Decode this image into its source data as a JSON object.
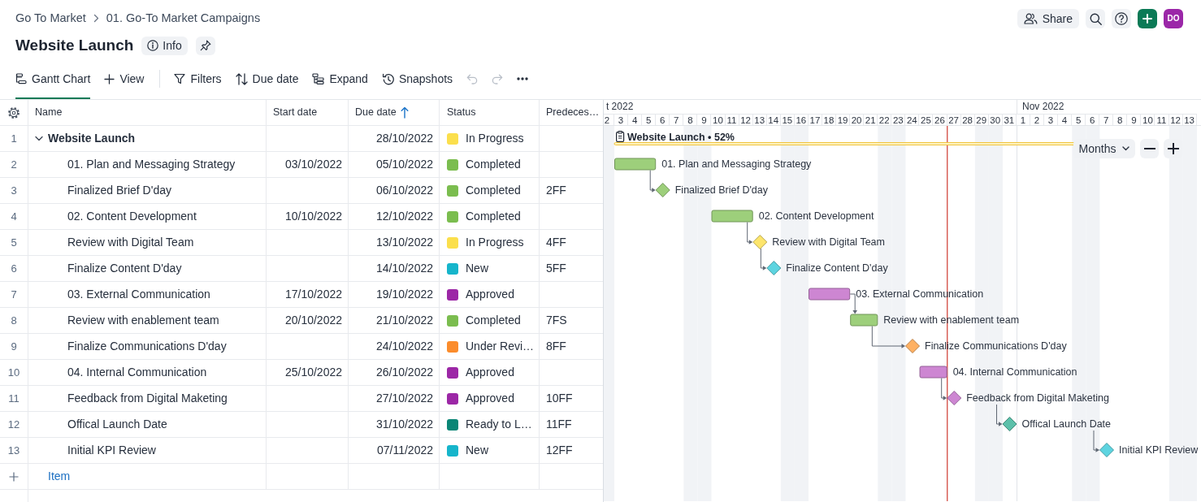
{
  "breadcrumb": [
    "Go To Market",
    "01. Go-To Market Campaigns"
  ],
  "title": "Website Launch",
  "info_button": "Info",
  "share_button": "Share",
  "avatar": "DO",
  "tabs": [
    {
      "label": "Gantt Chart",
      "selected": true
    }
  ],
  "add_view": "View",
  "toolbar": [
    "Filters",
    "Due date",
    "Expand",
    "Snapshots"
  ],
  "undo": {
    "disabled": true
  },
  "redo": {
    "disabled": true
  },
  "table": {
    "columns": [
      {
        "label": "Name",
        "sorted": false
      },
      {
        "label": "Start date",
        "sorted": false
      },
      {
        "label": "Due date",
        "sorted": true
      },
      {
        "label": "Status",
        "sorted": false
      },
      {
        "label": "Predeces…",
        "sorted": false
      }
    ],
    "rows": [
      {
        "number": "1",
        "name": "Website Launch",
        "due": "28/10/2022",
        "status": {
          "label": "In Progress",
          "color": "#fbdf4c"
        },
        "expanded": true,
        "children": [
          {
            "number": "2",
            "name": "01. Plan and Messaging Strategy",
            "start": "03/10/2022",
            "due": "05/10/2022",
            "status": {
              "label": "Completed",
              "color": "#7bbd4f"
            }
          },
          {
            "number": "3",
            "name": "Finalized Brief D'day",
            "due": "06/10/2022",
            "status": {
              "label": "Completed",
              "color": "#7bbd4f"
            },
            "predecessors": "2FF"
          },
          {
            "number": "4",
            "name": "02. Content Development",
            "start": "10/10/2022",
            "due": "12/10/2022",
            "status": {
              "label": "Completed",
              "color": "#7bbd4f"
            }
          },
          {
            "number": "5",
            "name": "Review with Digital Team",
            "due": "13/10/2022",
            "status": {
              "label": "In Progress",
              "color": "#fbdf4c"
            },
            "predecessors": "4FF"
          },
          {
            "number": "6",
            "name": "Finalize Content D'day",
            "due": "14/10/2022",
            "status": {
              "label": "New",
              "color": "#16b5cb"
            },
            "predecessors": "5FF"
          },
          {
            "number": "7",
            "name": "03. External Communication",
            "start": "17/10/2022",
            "due": "19/10/2022",
            "status": {
              "label": "Approved",
              "color": "#9c27a6"
            }
          },
          {
            "number": "8",
            "name": "Review with enablement team",
            "start": "20/10/2022",
            "due": "21/10/2022",
            "status": {
              "label": "Completed",
              "color": "#7bbd4f"
            },
            "predecessors": "7FS"
          },
          {
            "number": "9",
            "name": "Finalize Communications D'day",
            "due": "24/10/2022",
            "status": {
              "label": "Under Revi…",
              "color": "#fb8c2c"
            },
            "predecessors": "8FF"
          },
          {
            "number": "10",
            "name": "04. Internal Communication",
            "start": "25/10/2022",
            "due": "26/10/2022",
            "status": {
              "label": "Approved",
              "color": "#9c27a6"
            }
          },
          {
            "number": "11",
            "name": "Feedback from Digital Maketing",
            "due": "27/10/2022",
            "status": {
              "label": "Approved",
              "color": "#9c27a6"
            },
            "predecessors": "10FF"
          },
          {
            "number": "12",
            "name": "Offical Launch Date",
            "due": "31/10/2022",
            "status": {
              "label": "Ready to L…",
              "color": "#0b8676"
            },
            "predecessors": "11FF"
          },
          {
            "number": "13",
            "name": "Initial KPI Review",
            "due": "07/11/2022",
            "status": {
              "label": "New",
              "color": "#16b5cb"
            },
            "predecessors": "12FF"
          }
        ]
      }
    ],
    "add_row": "Item"
  },
  "gantt": {
    "months": [
      {
        "label": "t 2022",
        "days": [
          {
            "label": "2",
            "weekend": true,
            "today": false
          },
          {
            "label": "3",
            "weekend": false,
            "today": false
          },
          {
            "label": "4",
            "weekend": false,
            "today": false
          },
          {
            "label": "5",
            "weekend": false,
            "today": false
          },
          {
            "label": "6",
            "weekend": false,
            "today": false
          },
          {
            "label": "7",
            "weekend": false,
            "today": false
          },
          {
            "label": "8",
            "weekend": true,
            "today": false
          },
          {
            "label": "9",
            "weekend": true,
            "today": false
          },
          {
            "label": "10",
            "weekend": false,
            "today": false
          },
          {
            "label": "11",
            "weekend": false,
            "today": false
          },
          {
            "label": "12",
            "weekend": false,
            "today": false
          },
          {
            "label": "13",
            "weekend": false,
            "today": false
          },
          {
            "label": "14",
            "weekend": false,
            "today": false
          },
          {
            "label": "15",
            "weekend": true,
            "today": false
          },
          {
            "label": "16",
            "weekend": true,
            "today": false
          },
          {
            "label": "17",
            "weekend": false,
            "today": false
          },
          {
            "label": "18",
            "weekend": false,
            "today": false
          },
          {
            "label": "19",
            "weekend": false,
            "today": false
          },
          {
            "label": "20",
            "weekend": false,
            "today": false
          },
          {
            "label": "21",
            "weekend": false,
            "today": false
          },
          {
            "label": "22",
            "weekend": true,
            "today": false
          },
          {
            "label": "23",
            "weekend": true,
            "today": false
          },
          {
            "label": "24",
            "weekend": false,
            "today": false
          },
          {
            "label": "25",
            "weekend": false,
            "today": false
          },
          {
            "label": "26",
            "weekend": false,
            "today": false
          },
          {
            "label": "27",
            "weekend": false,
            "today": true
          },
          {
            "label": "28",
            "weekend": false,
            "today": false
          },
          {
            "label": "29",
            "weekend": true,
            "today": false
          },
          {
            "label": "30",
            "weekend": true,
            "today": false
          },
          {
            "label": "31",
            "weekend": false,
            "today": false
          }
        ]
      },
      {
        "label": "Nov 2022",
        "days": [
          {
            "label": "1",
            "weekend": false,
            "today": false
          },
          {
            "label": "2",
            "weekend": false,
            "today": false
          },
          {
            "label": "3",
            "weekend": false,
            "today": false
          },
          {
            "label": "4",
            "weekend": false,
            "today": false
          },
          {
            "label": "5",
            "weekend": true,
            "today": false
          },
          {
            "label": "6",
            "weekend": true,
            "today": false
          },
          {
            "label": "7",
            "weekend": false,
            "today": false
          },
          {
            "label": "8",
            "weekend": false,
            "today": false
          },
          {
            "label": "9",
            "weekend": false,
            "today": false
          },
          {
            "label": "10",
            "weekend": false,
            "today": false
          },
          {
            "label": "11",
            "weekend": false,
            "today": false
          },
          {
            "label": "12",
            "weekend": true,
            "today": false
          },
          {
            "label": "13",
            "weekend": true,
            "today": false
          }
        ]
      }
    ],
    "summary": "Website Launch • 52%",
    "items": [
      {
        "label": "01. Plan and Messaging Strategy",
        "kind": "bar",
        "color": "#9dcf7b"
      },
      {
        "label": "Finalized Brief D'day",
        "kind": "milestone",
        "color": "#9dcf7b"
      },
      {
        "label": "02. Content Development",
        "kind": "bar",
        "color": "#9dcf7b"
      },
      {
        "label": "Review with Digital Team",
        "kind": "milestone",
        "color": "#fde56c"
      },
      {
        "label": "Finalize Content D'day",
        "kind": "milestone",
        "color": "#5dd4e0"
      },
      {
        "label": "03. External Communication",
        "kind": "bar",
        "color": "#cd86d2"
      },
      {
        "label": "Review with enablement team",
        "kind": "bar",
        "color": "#9dcf7b"
      },
      {
        "label": "Finalize Communications D'day",
        "kind": "milestone",
        "color": "#ffb163"
      },
      {
        "label": "04. Internal Communication",
        "kind": "bar",
        "color": "#cd86d2"
      },
      {
        "label": "Feedback from Digital Maketing",
        "kind": "milestone",
        "color": "#cd86d2"
      },
      {
        "label": "Offical Launch Date",
        "kind": "milestone",
        "color": "#5cc0aa"
      },
      {
        "label": "Initial KPI Review",
        "kind": "milestone",
        "color": "#5dd4e0"
      }
    ],
    "scale": "Months"
  }
}
